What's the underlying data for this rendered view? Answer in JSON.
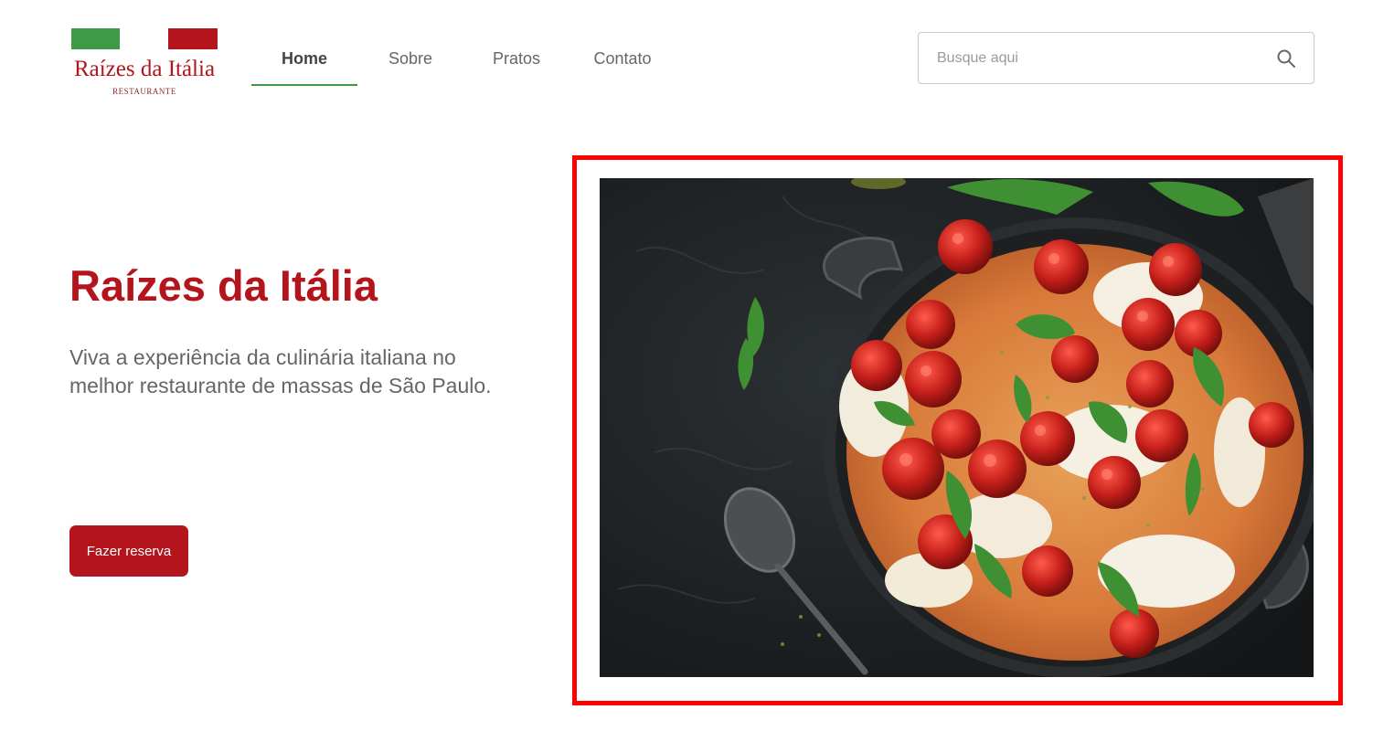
{
  "logo": {
    "title": "Raízes da Itália",
    "subtitle": "RESTAURANTE",
    "colors": {
      "green": "#3e9a45",
      "red": "#b4141c"
    }
  },
  "nav": {
    "items": [
      {
        "label": "Home",
        "active": true
      },
      {
        "label": "Sobre",
        "active": false
      },
      {
        "label": "Pratos",
        "active": false
      },
      {
        "label": "Contato",
        "active": false
      }
    ]
  },
  "search": {
    "placeholder": "Busque aqui",
    "icon": "search-icon"
  },
  "hero": {
    "title": "Raízes da Itália",
    "subtitle": "Viva a experiência da culinária italiana no melhor restaurante de massas de São Paulo.",
    "cta_label": "Fazer reserva"
  },
  "image": {
    "alt": "pasta-dish-photo",
    "frame_color": "#ff0000"
  },
  "colors": {
    "brand_red": "#b4141c",
    "accent_green": "#3e9a45",
    "text_gray": "#666666"
  }
}
